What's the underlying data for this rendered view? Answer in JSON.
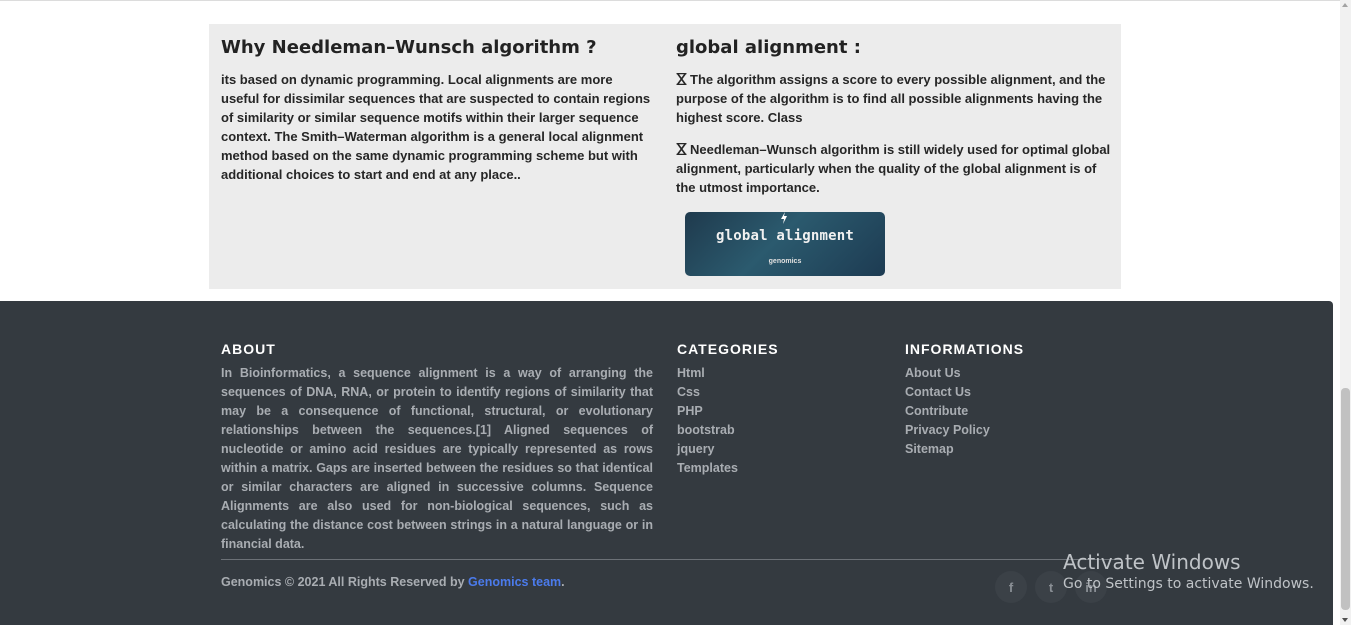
{
  "intro": {
    "left_title": "Why Needleman–Wunsch algorithm ?",
    "left_text": "its based on dynamic programming. Local alignments are more useful for dissimilar sequences that are suspected to contain regions of similarity or similar sequence motifs within their larger sequence context. The Smith–Waterman algorithm is a general local alignment method based on the same dynamic programming scheme but with additional choices to start and end at any place..",
    "right_title": "global alignment :",
    "points": [
      "The algorithm assigns a score to every possible alignment, and the purpose of the algorithm is to find all possible alignments having the highest score. Class",
      "Needleman–Wunsch algorithm is still widely used for optimal global alignment, particularly when the quality of the global alignment is of the utmost importance."
    ],
    "image": {
      "title": "global alignment",
      "subtitle": "genomics"
    }
  },
  "footer": {
    "about_heading": "ABOUT",
    "about_text": "In Bioinformatics, a sequence alignment is a way of arranging the sequences of DNA, RNA, or protein to identify regions of similarity that may be a consequence of functional, structural, or evolutionary relationships between the sequences.[1] Aligned sequences of nucleotide or amino acid residues are typically represented as rows within a matrix. Gaps are inserted between the residues so that identical or similar characters are aligned in successive columns. Sequence Alignments are also used for non-biological sequences, such as calculating the distance cost between strings in a natural language or in financial data.",
    "categories_heading": "CATEGORIES",
    "categories": [
      "Html",
      "Css",
      "PHP",
      "bootstrab",
      "jquery",
      "Templates"
    ],
    "informations_heading": "INFORMATIONS",
    "informations": [
      "About Us",
      "Contact Us",
      "Contribute",
      "Privacy Policy",
      "Sitemap"
    ],
    "copyright_prefix": "Genomics © 2021 All Rights Reserved by ",
    "copyright_link": "Genomics team",
    "copyright_suffix": ".",
    "social": [
      {
        "icon": "facebook-icon",
        "glyph": "f"
      },
      {
        "icon": "twitter-icon",
        "glyph": "t"
      },
      {
        "icon": "linkedin-icon",
        "glyph": "in"
      }
    ]
  },
  "watermark": {
    "title": "Activate Windows",
    "subtitle": "Go to Settings to activate Windows."
  },
  "colors": {
    "footer_bg": "#343a40",
    "section_bg": "#ececec",
    "link_accent": "#4b7bec"
  }
}
